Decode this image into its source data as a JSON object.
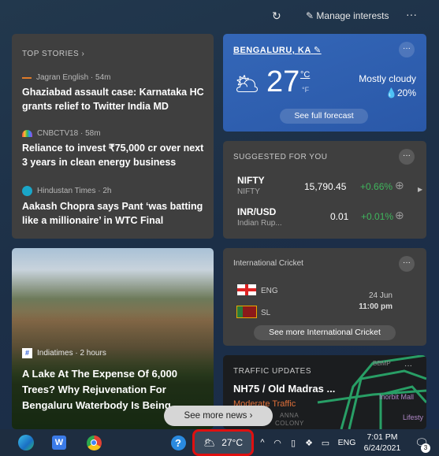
{
  "header": {
    "manage_label": "Manage interests"
  },
  "top_stories": {
    "heading": "TOP STORIES",
    "items": [
      {
        "source": "Jagran English · 54m",
        "title": "Ghaziabad assault case: Karnataka HC grants relief to Twitter India MD"
      },
      {
        "source": "CNBCTV18 · 58m",
        "title": "Reliance to invest ₹75,000 cr over next 3 years in clean energy business"
      },
      {
        "source": "Hindustan Times · 2h",
        "title": "Aakash Chopra says Pant ‘was batting like a millionaire’ in WTC Final"
      }
    ]
  },
  "weather": {
    "location": "BENGALURU, KA",
    "temp": "27",
    "unit_c": "°C",
    "unit_f": "°F",
    "condition": "Mostly cloudy",
    "precip": "20%",
    "forecast_label": "See full forecast",
    "bg_color": "#2f5fae"
  },
  "suggested": {
    "heading": "SUGGESTED FOR YOU",
    "stocks": [
      {
        "symbol": "NIFTY",
        "name": "NIFTY",
        "price": "15,790.45",
        "change": "+0.66%"
      },
      {
        "symbol": "INR/USD",
        "name": "Indian Rup...",
        "price": "0.01",
        "change": "+0.01%"
      }
    ],
    "up_color": "#3fb55c"
  },
  "news_card": {
    "source": "Indiatimes · 2 hours",
    "title": "A Lake At The Expense Of 6,000 Trees? Why Rejuvenation For Bengaluru Waterbody Is Being"
  },
  "cricket": {
    "heading": "International Cricket",
    "team1": "ENG",
    "team2": "SL",
    "date": "24 Jun",
    "time": "11:00 pm",
    "more_label": "See more International Cricket"
  },
  "traffic": {
    "heading": "TRAFFIC UPDATES",
    "road": "NH75 / Old Madras ...",
    "status": "Moderate Traffic",
    "map_labels": [
      "BBMP",
      "Inorbit Mall",
      "Lifesty",
      "ANNA",
      "COLONY"
    ]
  },
  "see_more_news": "See more news",
  "taskbar": {
    "weather_temp": "27°C",
    "lang": "ENG",
    "time": "7:01 PM",
    "date": "6/24/2021",
    "notif_count": "3"
  }
}
